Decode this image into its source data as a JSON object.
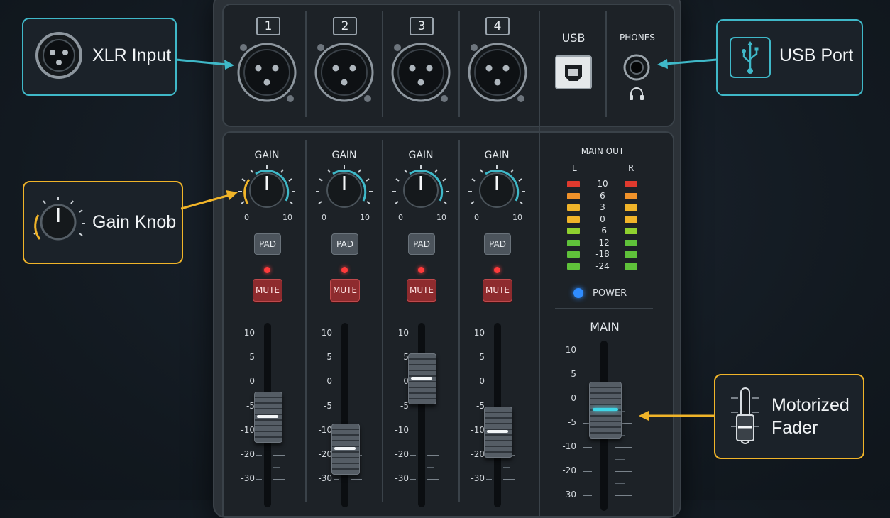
{
  "channels": [
    {
      "number": "1",
      "gain_label": "GAIN",
      "gain_min": "0",
      "gain_max": "10",
      "pad_label": "PAD",
      "mute_label": "MUTE"
    },
    {
      "number": "2",
      "gain_label": "GAIN",
      "gain_min": "0",
      "gain_max": "10",
      "pad_label": "PAD",
      "mute_label": "MUTE"
    },
    {
      "number": "3",
      "gain_label": "GAIN",
      "gain_min": "0",
      "gain_max": "10",
      "pad_label": "PAD",
      "mute_label": "MUTE"
    },
    {
      "number": "4",
      "gain_label": "GAIN",
      "gain_min": "0",
      "gain_max": "10",
      "pad_label": "PAD",
      "mute_label": "MUTE"
    }
  ],
  "fader_scale": [
    "10",
    "5",
    "0",
    "-5",
    "-10",
    "-20",
    "-30"
  ],
  "channel_fader_levels_db": [
    -7,
    -17,
    1,
    -10
  ],
  "usb_label": "USB",
  "phones_label": "PHONES",
  "meter": {
    "title": "MAIN OUT",
    "left_label": "L",
    "right_label": "R",
    "levels": [
      "10",
      "6",
      "3",
      "0",
      "-6",
      "-12",
      "-18",
      "-24"
    ]
  },
  "power_label": "POWER",
  "main": {
    "title": "MAIN",
    "scale": [
      "10",
      "5",
      "0",
      "-5",
      "-10",
      "-20",
      "-30"
    ],
    "level_db": -2
  },
  "callouts": {
    "xlr": "XLR Input",
    "usb": "USB Port",
    "gain": "Gain Knob",
    "fader_line1": "Motorized",
    "fader_line2": "Fader"
  },
  "colors": {
    "teal_accent": "#3fb8c8",
    "gold_accent": "#f0b429",
    "mute_red": "#8e2b2e",
    "led_red": "#ff3b3b",
    "power_blue": "#2f8cff"
  }
}
